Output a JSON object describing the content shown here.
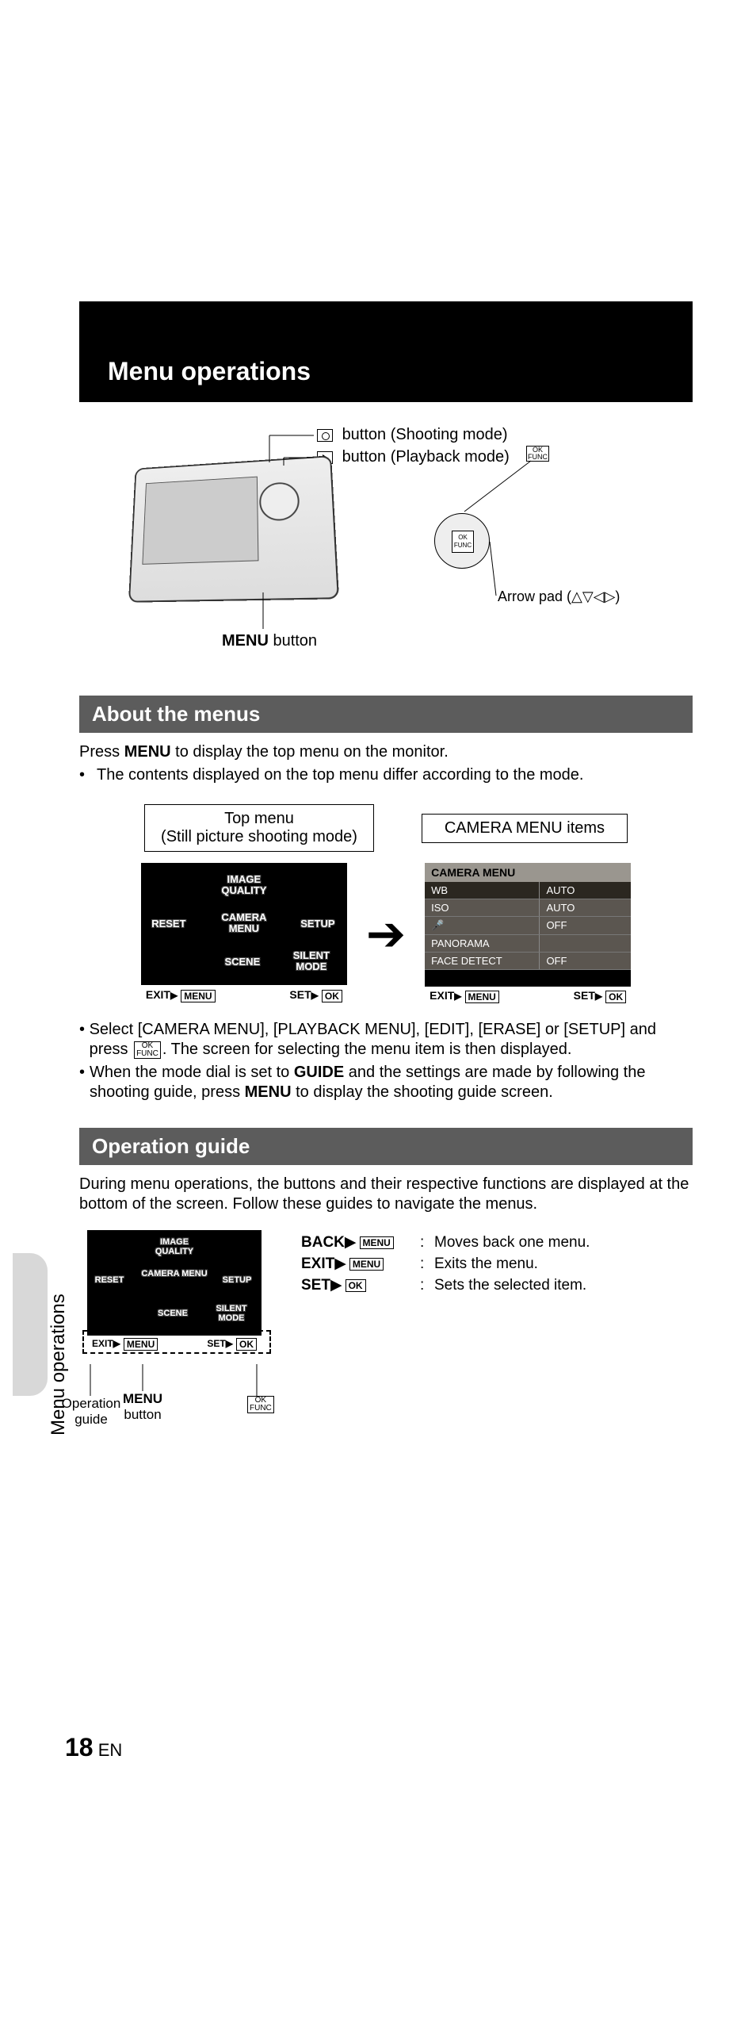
{
  "chapter": {
    "title": "Menu operations"
  },
  "side_tab_label": "Menu operations",
  "page_number": "18",
  "page_lang": "EN",
  "callouts": {
    "shooting": "button (Shooting mode)",
    "playback": "button (Playback mode)",
    "menu_button_prefix": "MENU",
    "menu_button_suffix": " button",
    "arrow_pad": "Arrow pad (",
    "arrow_pad_icons": "△▽◁▷",
    "arrow_pad_close": ")",
    "ok_top": "OK",
    "ok_bottom": "FUNC"
  },
  "sections": {
    "about_menus": "About the menus",
    "operation_guide": "Operation guide"
  },
  "about": {
    "line1a": "Press ",
    "line1b": "MENU",
    "line1c": " to display the top menu on the monitor.",
    "bullet1": "The contents displayed on the top menu differ according to the mode.",
    "box_top_menu_l1": "Top menu",
    "box_top_menu_l2": "(Still picture shooting mode)",
    "box_camera_items": "CAMERA MENU items",
    "bullet2a": "Select [CAMERA MENU], [PLAYBACK MENU], [EDIT], [ERASE] or [SETUP] and press ",
    "bullet2b": ". The screen for selecting the menu item is then displayed.",
    "bullet3a": "When the mode dial is set to ",
    "bullet3b": "GUIDE",
    "bullet3c": " and the settings are made by following the shooting guide, press ",
    "bullet3d": "MENU",
    "bullet3e": " to display the shooting guide screen."
  },
  "top_menu_screen": {
    "image_quality": "IMAGE QUALITY",
    "reset": "RESET",
    "camera_menu": "CAMERA MENU",
    "setup": "SETUP",
    "scene": "SCENE",
    "silent": "SILENT MODE",
    "footer_exit": "EXIT",
    "footer_exit_kbd": "MENU",
    "footer_set": "SET",
    "footer_set_kbd": "OK"
  },
  "camera_menu_screen": {
    "title": "CAMERA MENU",
    "rows": [
      {
        "k": "WB",
        "v": "AUTO"
      },
      {
        "k": "ISO",
        "v": "AUTO"
      },
      {
        "k": "🎤",
        "v": "OFF"
      },
      {
        "k": "PANORAMA",
        "v": ""
      },
      {
        "k": "FACE DETECT",
        "v": "OFF"
      }
    ],
    "footer_exit": "EXIT",
    "footer_exit_kbd": "MENU",
    "footer_set": "SET",
    "footer_set_kbd": "OK"
  },
  "opguide": {
    "intro": "During menu operations, the buttons and their respective functions are displayed at the bottom of the screen. Follow these guides to navigate the menus.",
    "legend": [
      {
        "label": "BACK",
        "kbd": "MENU",
        "desc": "Moves back one menu."
      },
      {
        "label": "EXIT",
        "kbd": "MENU",
        "desc": "Exits the menu."
      },
      {
        "label": "SET",
        "kbd": "OK",
        "desc": "Sets the selected item."
      }
    ],
    "op_guide_label": "Operation guide",
    "menu_button_l1": "MENU",
    "menu_button_l2": "button"
  }
}
